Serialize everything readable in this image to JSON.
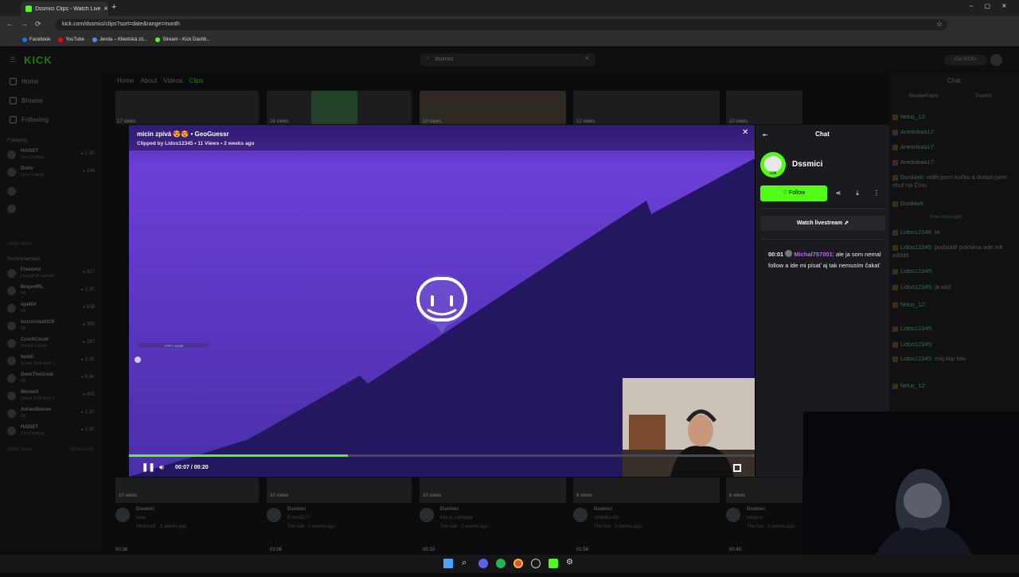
{
  "browser": {
    "tab_title": "Dssmici Clips - Watch Live ...",
    "url": "kick.com/dssmici/clips?sort=date&range=month",
    "bookmarks": [
      "Facebook",
      "YouTube",
      "Jenda – Klientská zó...",
      "Stream - Kick Dashb..."
    ]
  },
  "topnav": {
    "logo": "KICK",
    "search_value": "dssmici",
    "get_kicks": "Get KICKs"
  },
  "sidebar": {
    "nav": [
      "Home",
      "Browse",
      "Following"
    ],
    "following_label": "Following",
    "following": [
      {
        "name": "HAISET",
        "game": "Just Chatting",
        "viewers": "2.2K"
      },
      {
        "name": "Dodo",
        "game": "Just Chatting",
        "viewers": "234"
      }
    ],
    "show_more": "Show More",
    "recommended_label": "Recommended",
    "recommended": [
      {
        "name": "Freezecz",
        "game": "League of Legends",
        "viewers": "317"
      },
      {
        "name": "BrajenIRL",
        "game": "IRL",
        "viewers": "1.1K"
      },
      {
        "name": "opat04",
        "game": "IRL",
        "viewers": "838"
      },
      {
        "name": "buzrovinaKICK",
        "game": "IRL",
        "viewers": "380"
      },
      {
        "name": "CzechCloud",
        "game": "Slots & Casino",
        "viewers": "287"
      },
      {
        "name": "heddi",
        "game": "Grand Theft Auto V",
        "viewers": "1.2K"
      },
      {
        "name": "DeenTheGreat",
        "game": "IRL",
        "viewers": "8.5K"
      },
      {
        "name": "MarweX",
        "game": "Grand Theft Auto V",
        "viewers": "885"
      },
      {
        "name": "AdrienBroner",
        "game": "IRL",
        "viewers": "1.1K"
      },
      {
        "name": "HAISET",
        "game": "Just Chatting",
        "viewers": "2.2K"
      }
    ],
    "show_more_2": "Show More",
    "show_less": "Show Less"
  },
  "page_tabs": [
    "Home",
    "About",
    "Videos",
    "Clips"
  ],
  "grid_top_views": [
    "17 views",
    "24 views",
    "10 views",
    "12 views",
    "10 views"
  ],
  "grid_bottom": [
    {
      "views": "10 views",
      "channel": "Dssmici",
      "title": "here",
      "tag": "Minecraft",
      "ago": "2 weeks ago"
    },
    {
      "views": "10 views",
      "channel": "Dssmici",
      "title": "5 mostů??",
      "tag": "The Isle",
      "ago": "2 weeks ago"
    },
    {
      "views": "10 views",
      "channel": "Dssmici",
      "title": "kde je cathbeta",
      "tag": "The Isle",
      "ago": "2 weeks ago"
    },
    {
      "views": "9 views",
      "channel": "Dssmici",
      "title": "oddělila něc",
      "tag": "The Isle",
      "ago": "2 weeks ago"
    },
    {
      "views": "8 views",
      "channel": "Dssmici",
      "title": "teleport",
      "tag": "The Isle",
      "ago": "2 weeks ago"
    }
  ],
  "grid_durations": [
    "00:38",
    "01:06",
    "00:33",
    "01:56",
    "00:40"
  ],
  "modal": {
    "title": "micin zpívá 😍😍 • GeoGuessr",
    "clipped_by": "Clipped by Lidos12345 • 11 Views • 2 weeks ago",
    "time": "00:07 / 00:20",
    "progress": 0.35,
    "video_overlay_label": "PREY GAME"
  },
  "chat_panel": {
    "header": "Chat",
    "streamer": "Dssmici",
    "live_badge": "LIVE",
    "follow_label": "Follow",
    "watch_label": "Watch livestream",
    "message": {
      "time": "00:01",
      "user": "Michal757001",
      "text": ": ale ja som nemal follow a ide mi písať aj tak nemusím čakať"
    }
  },
  "right_chat": {
    "header": "Chat",
    "tags": [
      "BreakerKamo",
      "Dssmici"
    ],
    "divider": "New messages",
    "lines": [
      {
        "u": "helus_12:",
        "t": ""
      },
      {
        "u": "Anetinkaa17:",
        "t": ""
      },
      {
        "u": "Anetinkaa17:",
        "t": ""
      },
      {
        "u": "Anetinkaa17:",
        "t": ""
      },
      {
        "u": "Dunkiwit:",
        "t": " viděl jsem kočku a dostal jsem chuť na Čínu"
      },
      {
        "u": "Dunkiwit:",
        "t": ""
      },
      {
        "u": "Lidos12345:",
        "t": " kk"
      },
      {
        "u": "Lidos12345:",
        "t": " podstatě polovina ode mě xdddd"
      },
      {
        "u": "Lidos12345:",
        "t": ""
      },
      {
        "u": "Lidos12345:",
        "t": " já xdd"
      },
      {
        "u": "helus_12:",
        "t": ""
      },
      {
        "u": "Lidos12345:",
        "t": ""
      },
      {
        "u": "Lidos12345:",
        "t": ""
      },
      {
        "u": "Lidos12345:",
        "t": " můj klip btw"
      },
      {
        "u": "helus_12:",
        "t": ""
      }
    ]
  },
  "colors": {
    "accent": "#53fc18",
    "video_purple": "#6a3fd6",
    "video_dark": "#231860",
    "chat_user": "#b66bf5"
  }
}
